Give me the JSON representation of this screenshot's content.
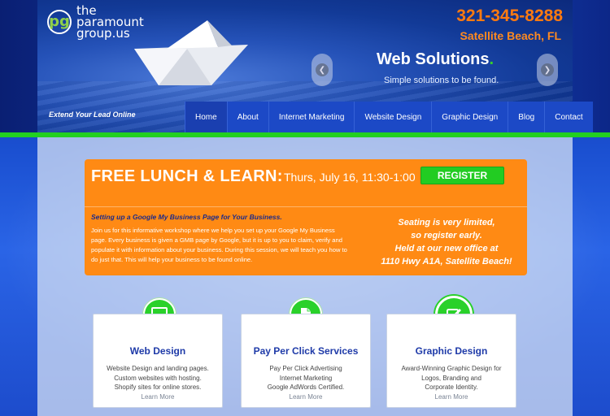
{
  "brand": {
    "logo_mark": "pg",
    "logo_lines": [
      "the",
      "paramount",
      "group.us"
    ],
    "tagline": "Extend Your Lead Online"
  },
  "contact": {
    "phone": "321-345-8288",
    "city": "Satellite Beach, FL"
  },
  "hero": {
    "title": "Web Solutions",
    "title_dot": ".",
    "subtitle": "Simple solutions to be found."
  },
  "nav": {
    "items": [
      {
        "label": "Home"
      },
      {
        "label": "About"
      },
      {
        "label": "Internet Marketing"
      },
      {
        "label": "Website Design"
      },
      {
        "label": "Graphic Design"
      },
      {
        "label": "Blog"
      },
      {
        "label": "Contact"
      }
    ]
  },
  "promo": {
    "title": "FREE LUNCH & LEARN:",
    "date": "Thurs, July 16, 11:30-1:00",
    "register_label": "REGISTER",
    "subtitle": "Setting up a Google My Business Page for Your Business.",
    "body": "Join us for this informative workshop where we help you set up your Google My Business page. Every business is given a GMB page by Google, but it is up to you to claim, verify and populate it with information about your business. During this session, we will teach you how to do just that. This will help your business to be found online.",
    "right_lines": [
      "Seating is very limited,",
      "so register early.",
      "Held at our new office at",
      "1110 Hwy A1A, Satellite Beach!"
    ]
  },
  "services": [
    {
      "title": "Web Design",
      "lines": [
        "Website Design and landing pages.",
        "Custom websites with hosting.",
        "Shopify sites for online stores."
      ],
      "more": "Learn More",
      "icon": "monitor-icon"
    },
    {
      "title": "Pay Per Click Services",
      "lines": [
        "Pay Per Click Advertising",
        "Internet Marketing",
        "Google AdWords Certified."
      ],
      "more": "Learn More",
      "icon": "document-icon"
    },
    {
      "title": "Graphic Design",
      "lines": [
        "Award-Winning Graphic Design for",
        "Logos, Branding and",
        "Corporate Identity."
      ],
      "more": "Learn More",
      "icon": "edit-icon"
    }
  ],
  "colors": {
    "accent_orange": "#ff8a14",
    "accent_green": "#22d020",
    "brand_blue": "#1c49c6"
  }
}
